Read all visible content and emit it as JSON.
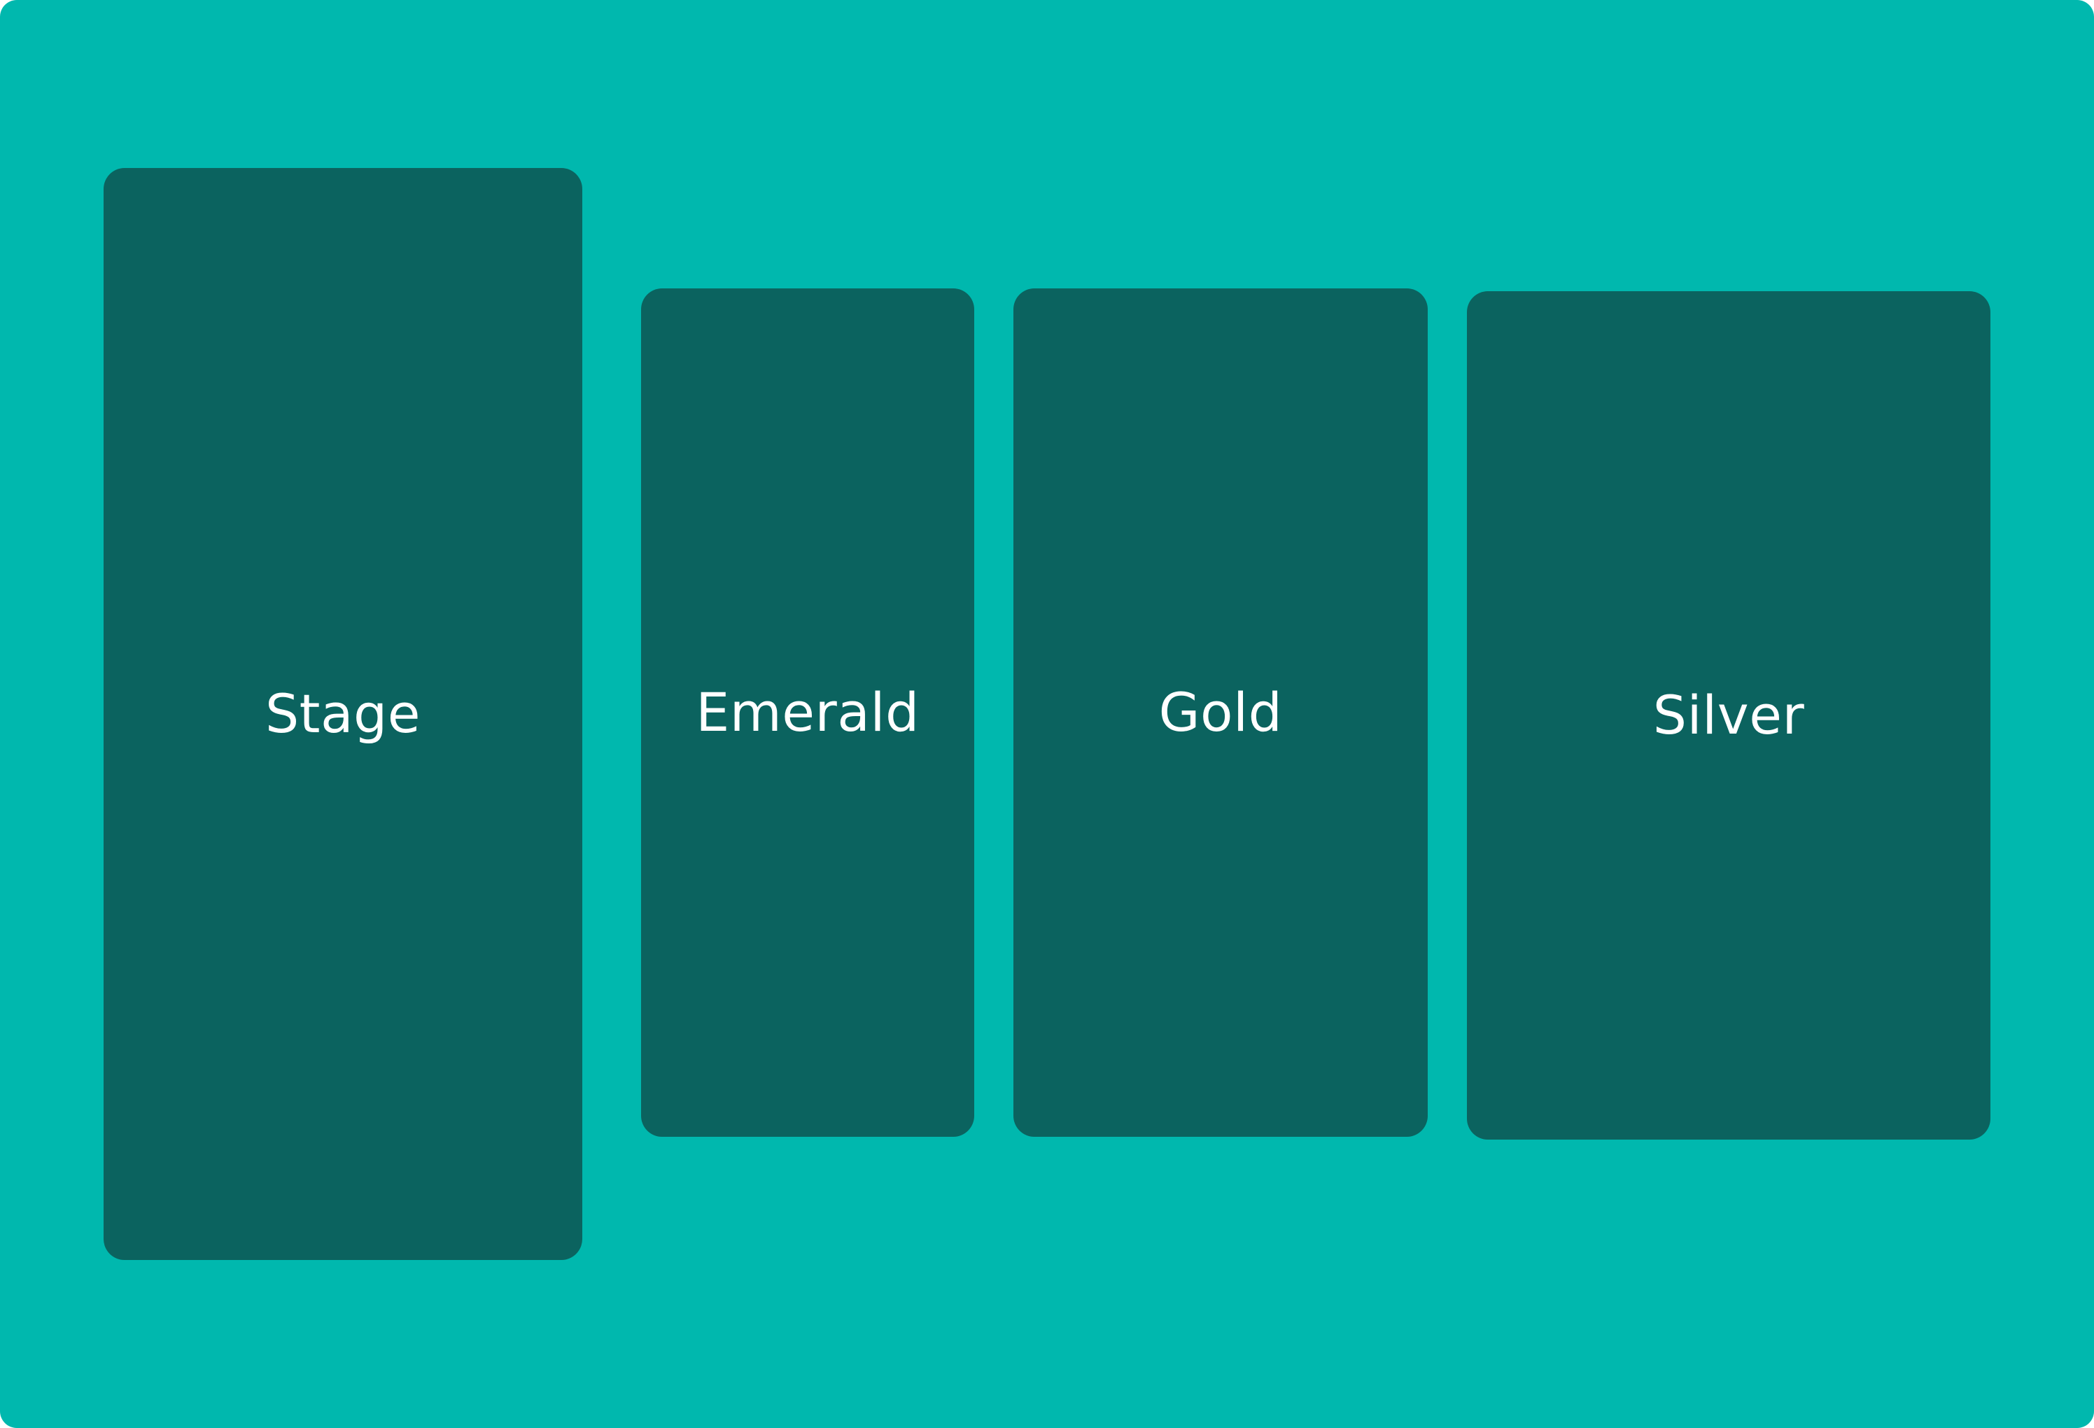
{
  "colors": {
    "background": "#00b8ae",
    "zone_fill": "#0b635f",
    "label_text": "#ffffff"
  },
  "zones": [
    {
      "label": "Stage"
    },
    {
      "label": "Emerald"
    },
    {
      "label": "Gold"
    },
    {
      "label": "Silver"
    }
  ]
}
